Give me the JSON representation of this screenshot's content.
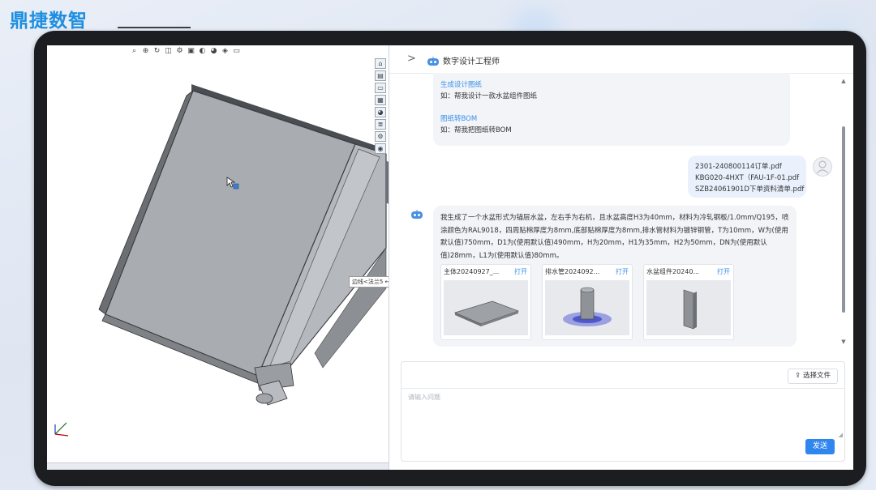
{
  "brand": {
    "name": "鼎捷数智",
    "color": "#1e8fe0"
  },
  "cad": {
    "toolbar_icons": [
      "zoom-icon",
      "zoom-area-icon",
      "rotate-icon",
      "section-icon",
      "display-icon",
      "view-orient-icon",
      "hide-icon",
      "appearance-icon",
      "scene-icon",
      "monitor-icon"
    ],
    "side_icons": [
      "home-icon",
      "part-icon",
      "folder-icon",
      "properties-icon",
      "appearance-icon",
      "list-icon",
      "gear-icon",
      "custom-icon"
    ],
    "callout": "边线<法兰5 ←"
  },
  "chat": {
    "header": {
      "chevron": ">",
      "title": "数字设计工程师"
    },
    "intro": {
      "link1": "生成设计图纸",
      "text1": "如：帮我设计一款水盆组件图纸",
      "link2": "图纸转BOM",
      "text2": "如：帮我把图纸转BOM"
    },
    "user_files": [
      "2301-240800114订单.pdf",
      "KBG020-4HXT（FAU-1F-01.pdf",
      "SZB24061901D下单资料清单.pdf"
    ],
    "reply": {
      "text": "我生成了一个水盆形式为锚层水盆，左右手为右机，且水盆高度H3为40mm，材料为冷轧钢板/1.0mm/Q195，喷涂颜色为RAL9018，四周贴棉厚度为8mm,底部贴棉厚度为8mm,排水管材料为镀锌钢管，T为10mm，W为(使用默认值)750mm，D1为(使用默认值)490mm，H为20mm，H1为35mm，H2为50mm，DN为(使用默认值)28mm，L1为(使用默认值)80mm。",
      "cards": [
        {
          "name": "主体20240927_...",
          "open": "打开"
        },
        {
          "name": "排水管2024092...",
          "open": "打开"
        },
        {
          "name": "水盆组件20240...",
          "open": "打开"
        }
      ]
    },
    "composer": {
      "file_button": "选择文件",
      "placeholder": "请输入问题",
      "send": "发送"
    },
    "accent": "#2f86ef"
  }
}
